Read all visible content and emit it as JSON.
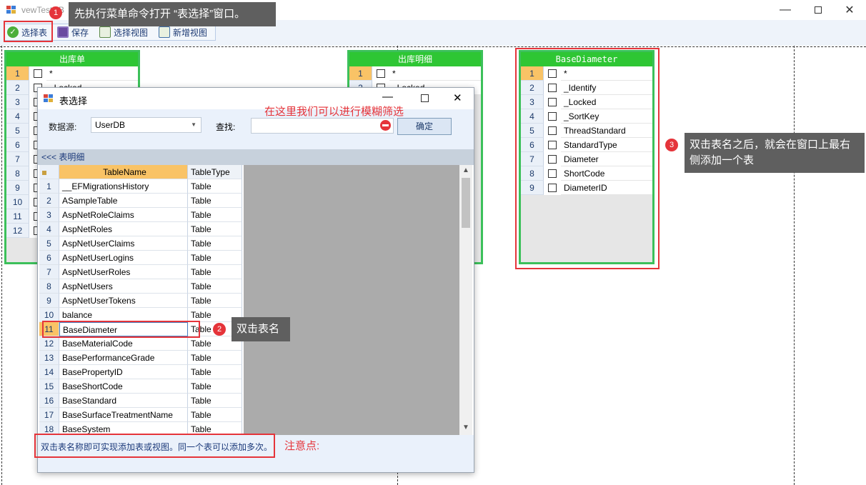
{
  "window": {
    "title": "vewTestDB"
  },
  "toolbar": {
    "items": [
      {
        "label": "选择表",
        "icon": "check-circle-icon"
      },
      {
        "label": "保存",
        "icon": "save-icon"
      },
      {
        "label": "选择视图",
        "icon": "select-view-icon"
      },
      {
        "label": "新增视图",
        "icon": "add-view-icon"
      }
    ]
  },
  "tables": [
    {
      "title": "出库单",
      "rows": [
        "1",
        "2",
        "3",
        "4",
        "5",
        "6",
        "7",
        "8",
        "9",
        "10",
        "11",
        "12"
      ],
      "first_field": "*",
      "second_field": "_Locked"
    },
    {
      "title": "出库明细",
      "rows": [
        "1",
        "2"
      ],
      "first_field": "*",
      "second_field": "_Locked"
    },
    {
      "title": "BaseDiameter",
      "fields": [
        {
          "num": "1",
          "name": "*"
        },
        {
          "num": "2",
          "name": "_Identify"
        },
        {
          "num": "3",
          "name": "_Locked"
        },
        {
          "num": "4",
          "name": "_SortKey"
        },
        {
          "num": "5",
          "name": "ThreadStandard"
        },
        {
          "num": "6",
          "name": "StandardType"
        },
        {
          "num": "7",
          "name": "Diameter"
        },
        {
          "num": "8",
          "name": "ShortCode"
        },
        {
          "num": "9",
          "name": "DiameterID"
        }
      ]
    }
  ],
  "dialog": {
    "title": "表选择",
    "datasource_label": "数据源:",
    "datasource_value": "UserDB",
    "search_label": "查找:",
    "search_value": "",
    "ok_label": "确定",
    "section_label": "<<< 表明细",
    "columns": [
      "TableName",
      "TableType"
    ],
    "rows": [
      [
        "1",
        "__EFMigrationsHistory",
        "Table"
      ],
      [
        "2",
        "ASampleTable",
        "Table"
      ],
      [
        "3",
        "AspNetRoleClaims",
        "Table"
      ],
      [
        "4",
        "AspNetRoles",
        "Table"
      ],
      [
        "5",
        "AspNetUserClaims",
        "Table"
      ],
      [
        "6",
        "AspNetUserLogins",
        "Table"
      ],
      [
        "7",
        "AspNetUserRoles",
        "Table"
      ],
      [
        "8",
        "AspNetUsers",
        "Table"
      ],
      [
        "9",
        "AspNetUserTokens",
        "Table"
      ],
      [
        "10",
        "balance",
        "Table"
      ],
      [
        "11",
        "BaseDiameter",
        "Table"
      ],
      [
        "12",
        "BaseMaterialCode",
        "Table"
      ],
      [
        "13",
        "BasePerformanceGrade",
        "Table"
      ],
      [
        "14",
        "BasePropertyID",
        "Table"
      ],
      [
        "15",
        "BaseShortCode",
        "Table"
      ],
      [
        "16",
        "BaseStandard",
        "Table"
      ],
      [
        "17",
        "BaseSurfaceTreatmentName",
        "Table"
      ],
      [
        "18",
        "BaseSystem",
        "Table"
      ]
    ],
    "status": "双击表名称即可实现添加表或视图。同一个表可以添加多次。"
  },
  "annotations": {
    "step1_badge": "1",
    "step1_text": "先执行菜单命令打开 “表选择”窗口。",
    "step2_badge": "2",
    "step2_text": "双击表名",
    "step3_badge": "3",
    "step3_text_line1": "双击表名之后，就会在窗口上最右",
    "step3_text_line2": "侧添加一个表",
    "filter_note": "在这里我们可以进行模糊筛选",
    "attention_note": "注意点:"
  },
  "colors": {
    "green": "#2ec634",
    "red": "#e5343a",
    "callout": "#5f5f5f"
  }
}
